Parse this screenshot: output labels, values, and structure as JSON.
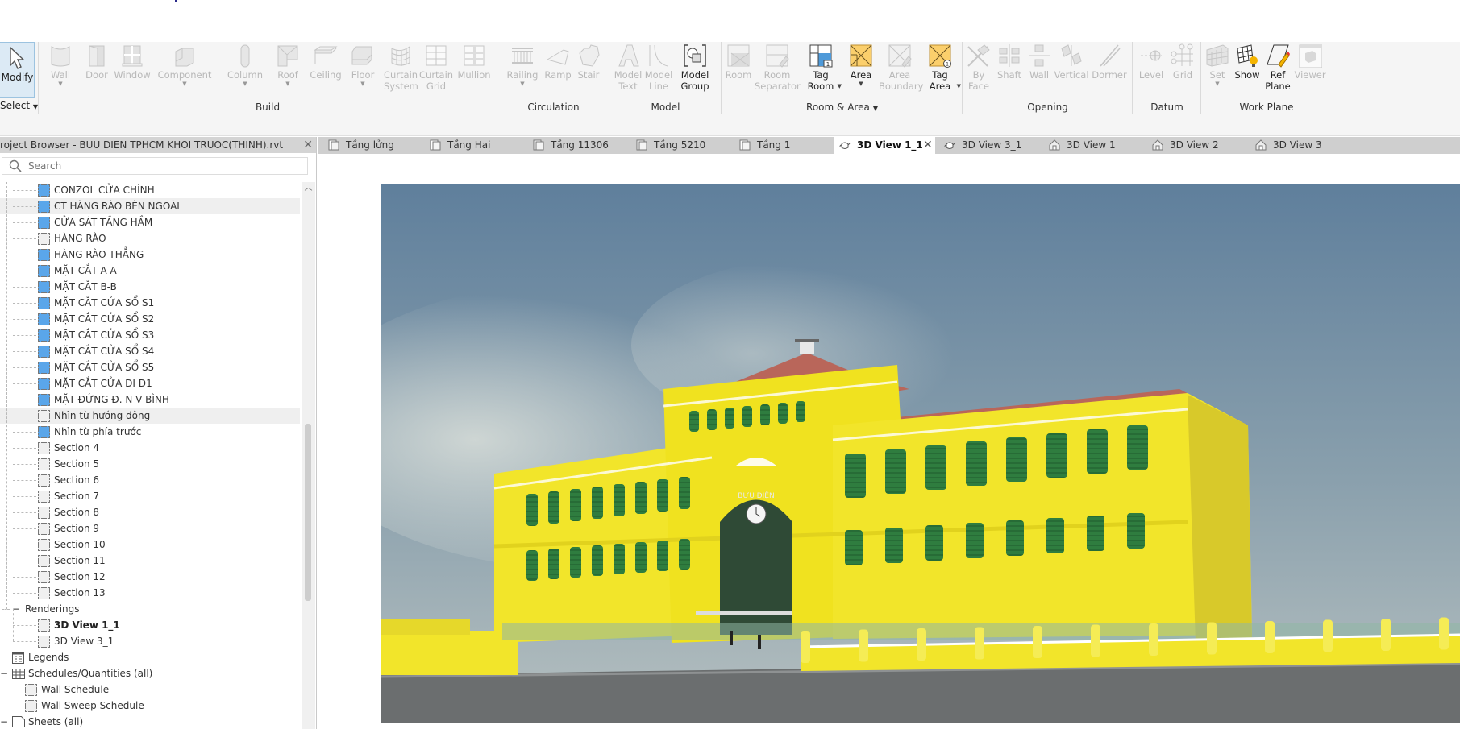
{
  "ribbon": {
    "modify": {
      "label": "Modify",
      "panel": "Select"
    },
    "panels": [
      {
        "title": "Build",
        "tools": [
          "Wall",
          "Door",
          "Window",
          "Component",
          "Column",
          "Roof",
          "Ceiling",
          "Floor",
          "Curtain System",
          "Curtain Grid",
          "Mullion"
        ]
      },
      {
        "title": "Circulation",
        "tools": [
          "Railing",
          "Ramp",
          "Stair"
        ]
      },
      {
        "title": "Model",
        "tools": [
          "Model Text",
          "Model Line",
          "Model Group"
        ]
      },
      {
        "title": "Room & Area",
        "tools": [
          "Room",
          "Room Separator",
          "Tag Room",
          "Area",
          "Area Boundary",
          "Tag Area"
        ]
      },
      {
        "title": "Opening",
        "tools": [
          "By Face",
          "Shaft",
          "Wall",
          "Vertical",
          "Dormer"
        ]
      },
      {
        "title": "Datum",
        "tools": [
          "Level",
          "Grid"
        ]
      },
      {
        "title": "Work Plane",
        "tools": [
          "Set",
          "Show",
          "Ref Plane",
          "Viewer"
        ]
      }
    ],
    "tool_labels": {
      "wall": "Wall",
      "door": "Door",
      "window": "Window",
      "component": "Component",
      "column": "Column",
      "roof": "Roof",
      "ceiling": "Ceiling",
      "floor": "Floor",
      "curtain_system_1": "Curtain",
      "curtain_system_2": "System",
      "curtain_grid_1": "Curtain",
      "curtain_grid_2": "Grid",
      "mullion": "Mullion",
      "railing": "Railing",
      "ramp": "Ramp",
      "stair": "Stair",
      "model_text_1": "Model",
      "model_text_2": "Text",
      "model_line_1": "Model",
      "model_line_2": "Line",
      "model_group_1": "Model",
      "model_group_2": "Group",
      "room": "Room",
      "room_sep_1": "Room",
      "room_sep_2": "Separator",
      "tag_room_1": "Tag",
      "tag_room_2": "Room",
      "area": "Area",
      "area_boundary_1": "Area",
      "area_boundary_2": "Boundary",
      "tag_area_1": "Tag",
      "tag_area_2": "Area",
      "by_face_1": "By",
      "by_face_2": "Face",
      "shaft": "Shaft",
      "op_wall": "Wall",
      "vertical": "Vertical",
      "dormer": "Dormer",
      "level": "Level",
      "grid": "Grid",
      "set": "Set",
      "show": "Show",
      "ref_plane_1": "Ref",
      "ref_plane_2": "Plane",
      "viewer": "Viewer"
    },
    "panel_titles": {
      "build": "Build",
      "circulation": "Circulation",
      "model": "Model",
      "room_area": "Room & Area",
      "opening": "Opening",
      "datum": "Datum",
      "work_plane": "Work Plane"
    },
    "dropdown_glyph": "▼",
    "badge_one": "1"
  },
  "project_browser": {
    "title": "roject Browser - BUU DIEN TPHCM KHOI TRUOC(THINH).rvt",
    "close": "✕",
    "search_placeholder": "Search",
    "items": [
      {
        "label": "CONZOL CỬA CHÍNH",
        "icon": "view-blue"
      },
      {
        "label": "CT HÀNG RÀO BÊN NGOÀI",
        "icon": "view-blue",
        "highlight": true
      },
      {
        "label": "CỬA SÁT TẦNG HẦM",
        "icon": "view-blue"
      },
      {
        "label": "HÀNG RÀO",
        "icon": "view-grey"
      },
      {
        "label": "HÀNG RÀO THẲNG",
        "icon": "view-blue"
      },
      {
        "label": "MẶT CẮT A-A",
        "icon": "view-blue"
      },
      {
        "label": "MẶT CẮT B-B",
        "icon": "view-blue"
      },
      {
        "label": "MẶT CẮT CỬA SỔ S1",
        "icon": "view-blue"
      },
      {
        "label": "MẶT CẮT CỬA SỔ S2",
        "icon": "view-blue"
      },
      {
        "label": "MẶT CẮT CỬA SỔ S3",
        "icon": "view-blue"
      },
      {
        "label": "MẶT CẮT CỬA SỔ S4",
        "icon": "view-blue"
      },
      {
        "label": "MẶT CẮT CỬA SỔ S5",
        "icon": "view-blue"
      },
      {
        "label": "MẶT CẮT CỬA ĐI Đ1",
        "icon": "view-blue"
      },
      {
        "label": "MẶT ĐỨNG Đ. N V BÌNH",
        "icon": "view-blue"
      },
      {
        "label": "Nhìn từ hướng đông",
        "icon": "view-grey",
        "highlight": true
      },
      {
        "label": "Nhìn từ phía trước",
        "icon": "view-blue"
      },
      {
        "label": "Section 4",
        "icon": "view-grey"
      },
      {
        "label": "Section 5",
        "icon": "view-grey"
      },
      {
        "label": "Section 6",
        "icon": "view-grey"
      },
      {
        "label": "Section 7",
        "icon": "view-grey"
      },
      {
        "label": "Section 8",
        "icon": "view-grey"
      },
      {
        "label": "Section 9",
        "icon": "view-grey"
      },
      {
        "label": "Section 10",
        "icon": "view-grey"
      },
      {
        "label": "Section 11",
        "icon": "view-grey"
      },
      {
        "label": "Section 12",
        "icon": "view-grey"
      },
      {
        "label": "Section 13",
        "icon": "view-grey"
      }
    ],
    "renderings": {
      "label": "Renderings",
      "toggle": "−",
      "children": [
        {
          "label": "3D View 1_1",
          "bold": true
        },
        {
          "label": "3D View 3_1",
          "bold": false
        }
      ]
    },
    "legends": {
      "label": "Legends"
    },
    "schedules": {
      "label": "Schedules/Quantities (all)",
      "toggle": "−",
      "children": [
        {
          "label": "Wall Schedule"
        },
        {
          "label": "Wall Sweep Schedule"
        }
      ]
    },
    "sheets": {
      "label": "Sheets (all)",
      "toggle": "−"
    }
  },
  "view_tabs": [
    {
      "label": "Tầng lửng",
      "icon": "floor-plan",
      "active": false
    },
    {
      "label": "Tầng Hai",
      "icon": "floor-plan",
      "active": false
    },
    {
      "label": "Tầng 11306",
      "icon": "floor-plan",
      "active": false
    },
    {
      "label": "Tầng 5210",
      "icon": "floor-plan",
      "active": false
    },
    {
      "label": "Tầng 1",
      "icon": "floor-plan",
      "active": false
    },
    {
      "label": "3D View 1_1",
      "icon": "teapot",
      "active": true
    },
    {
      "label": "3D View 3_1",
      "icon": "teapot",
      "active": false
    },
    {
      "label": "3D View 1",
      "icon": "house",
      "active": false
    },
    {
      "label": "3D View 2",
      "icon": "house",
      "active": false
    },
    {
      "label": "3D View 3",
      "icon": "house",
      "active": false
    }
  ],
  "viewport": {
    "rendering_subject": "Ho Chi Minh City Central Post Office",
    "facade_sign": "BƯU ĐIỆN",
    "colors": {
      "sky": "#6f8ea8",
      "facade": "#f2e52a",
      "roof": "#b9665a",
      "shutters": "#2f7d3f",
      "ground": "#6b6e6f"
    }
  },
  "close_tab_glyph": "✕"
}
